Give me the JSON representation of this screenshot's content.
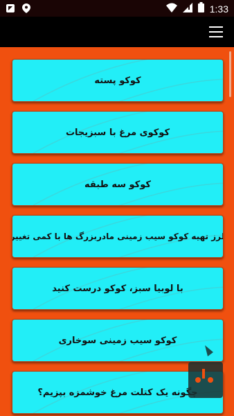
{
  "status_bar": {
    "time": "1:33",
    "icons": [
      "notification-icon",
      "location-icon",
      "wifi-icon",
      "cellular-icon",
      "battery-icon"
    ]
  },
  "app_bar": {
    "menu_icon": "hamburger-menu-icon"
  },
  "items": [
    {
      "label": "کوکو پسته"
    },
    {
      "label": "کوکوی مرغ با سبزیجات"
    },
    {
      "label": "کوکو سه طبقه"
    },
    {
      "label": "طرز تهیه کوکو سیب زمینی مادربزرگ ها با کمی تغییر!"
    },
    {
      "label": "با لوبیا سبز، کوکو درست کنید"
    },
    {
      "label": "کوکو سیب زمینی سوخاری"
    },
    {
      "label": "چگونه یک کتلت مرغ خوشمزه بپزیم؟"
    }
  ],
  "colors": {
    "background": "#f0500f",
    "card": "#22eef7",
    "status_bar": "#1a0505",
    "app_bar": "#000000"
  }
}
